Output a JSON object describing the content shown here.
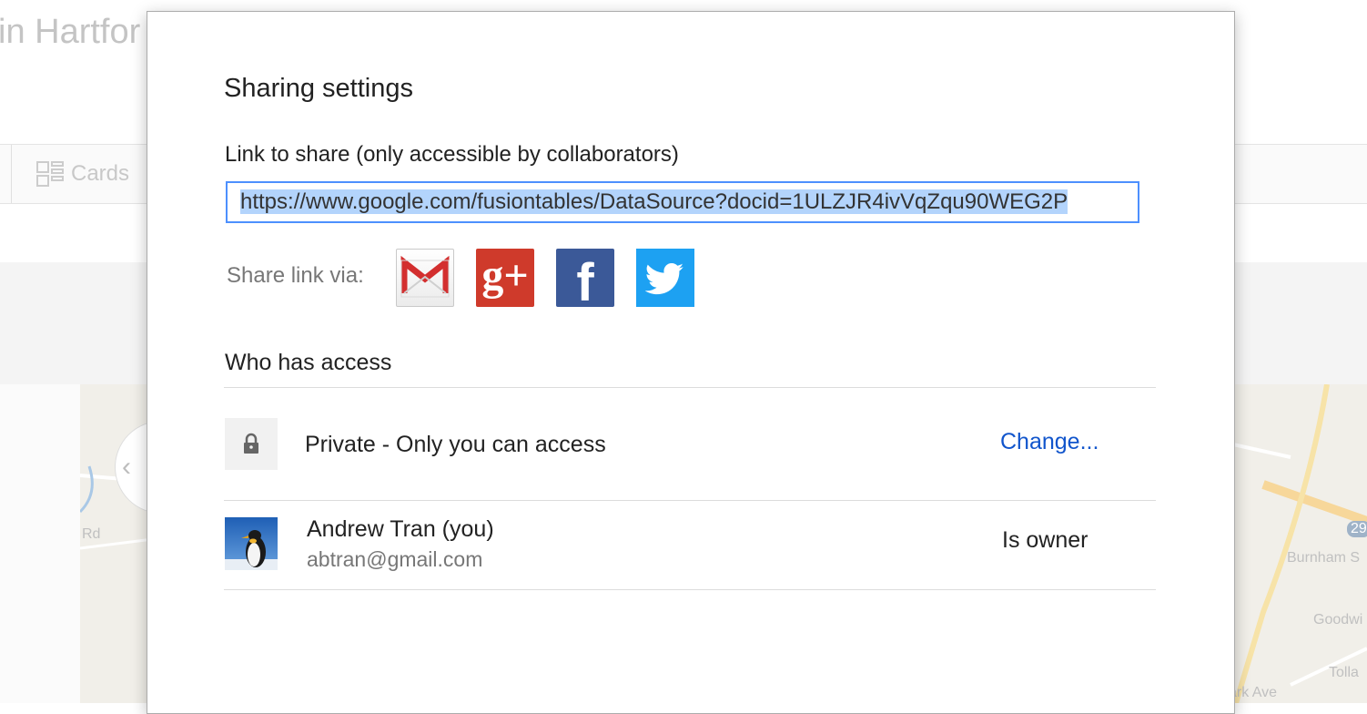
{
  "background": {
    "page_title": "in Hartfor",
    "tab_cards": "Cards",
    "map_labels": {
      "rd": "Rd",
      "burnham": "Burnham S",
      "goodwin": "Goodwi",
      "park_ave": "ark Ave",
      "tollan": "Tolla",
      "route": "29"
    }
  },
  "dialog": {
    "title": "Sharing settings",
    "link_label": "Link to share (only accessible by collaborators)",
    "link_value": "https://www.google.com/fusiontables/DataSource?docid=1ULZJR4ivVqZqu90WEG2P",
    "share_via_label": "Share link via:",
    "share_icons": [
      "gmail-icon",
      "google-plus-icon",
      "facebook-icon",
      "twitter-icon"
    ],
    "who_has_access_label": "Who has access",
    "access": {
      "icon": "lock-icon",
      "text": "Private - Only you can access",
      "change_label": "Change..."
    },
    "owner": {
      "name": "Andrew Tran (you)",
      "email": "abtran@gmail.com",
      "role": "Is owner"
    }
  },
  "colors": {
    "link_blue": "#1155cc",
    "focus_blue": "#4d90fe",
    "selection": "#b3d4fc",
    "twitter": "#1da1f2",
    "facebook": "#3b5998",
    "google_plus": "#cf3a2b",
    "gmail_red": "#d32f2f"
  }
}
